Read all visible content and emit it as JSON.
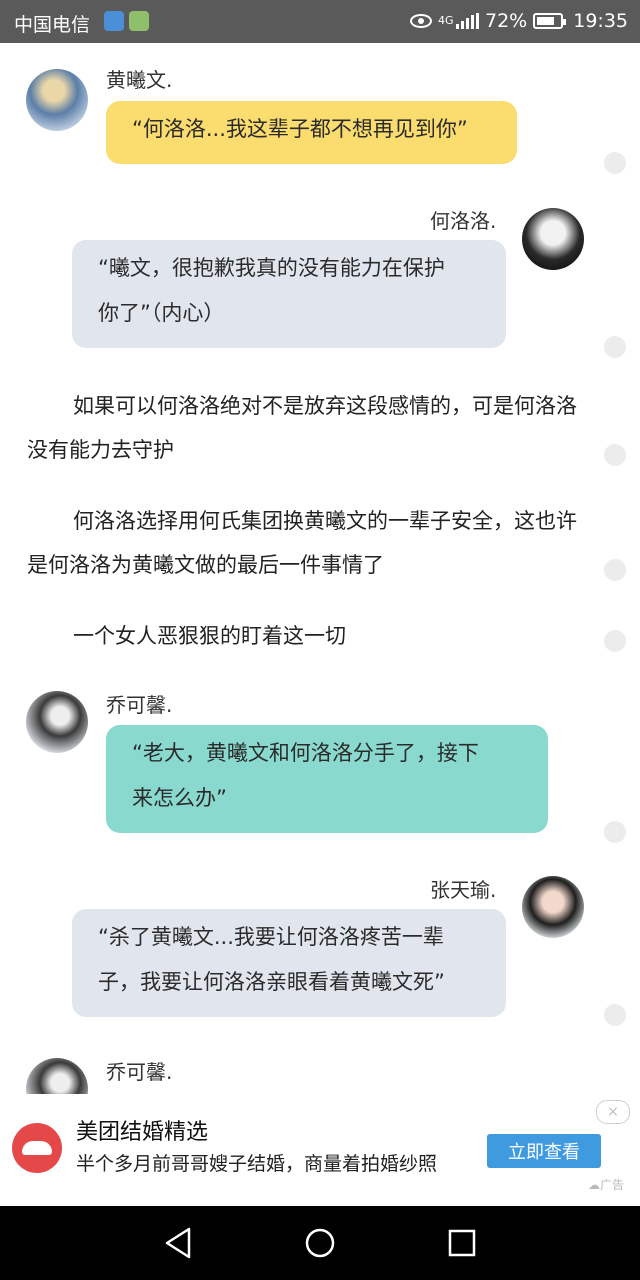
{
  "status_bar": {
    "carrier": "中国电信",
    "network_type": "4G",
    "battery": "72%",
    "time": "19:35",
    "icons": [
      "wifi-hotspot-icon",
      "app-notification-icon",
      "eye-comfort-icon",
      "signal-icon",
      "battery-icon"
    ]
  },
  "chat": {
    "msg1": {
      "speaker": "黄曦文.",
      "text": "“何洛洛...我这辈子都不想再见到你”"
    },
    "msg2": {
      "speaker": "何洛洛.",
      "line1": "“曦文，很抱歉我真的没有能力在保护",
      "line2": "你了”（内心）"
    },
    "narration1": "如果可以何洛洛绝对不是放弃这段感情的，可是何洛洛没有能力去守护",
    "narration2": "何洛洛选择用何氏集团换黄曦文的一辈子安全，这也许是何洛洛为黄曦文做的最后一件事情了",
    "narration3": "一个女人恶狠狠的盯着这一切",
    "msg3": {
      "speaker": "乔可馨.",
      "line1": "“老大，黄曦文和何洛洛分手了，接下",
      "line2": "来怎么办”"
    },
    "msg4": {
      "speaker": "张天瑜.",
      "line1": "“杀了黄曦文...我要让何洛洛疼苦一辈",
      "line2": "子，我要让何洛洛亲眼看着黄曦文死”"
    },
    "msg5": {
      "speaker": "乔可馨."
    }
  },
  "ad": {
    "title": "美团结婚精选",
    "description": "半个多月前哥哥嫂子结婚，商量着拍婚纱照",
    "button": "立即查看",
    "label": "广告",
    "close": "×"
  },
  "nav": {
    "icons": [
      "back-icon",
      "home-icon",
      "recents-icon"
    ]
  },
  "colors": {
    "yellow_bubble": "#fbdc6e",
    "grey_bubble": "#e1e6ee",
    "teal_bubble": "#8ad9ce",
    "ad_button": "#3f9ae0"
  }
}
